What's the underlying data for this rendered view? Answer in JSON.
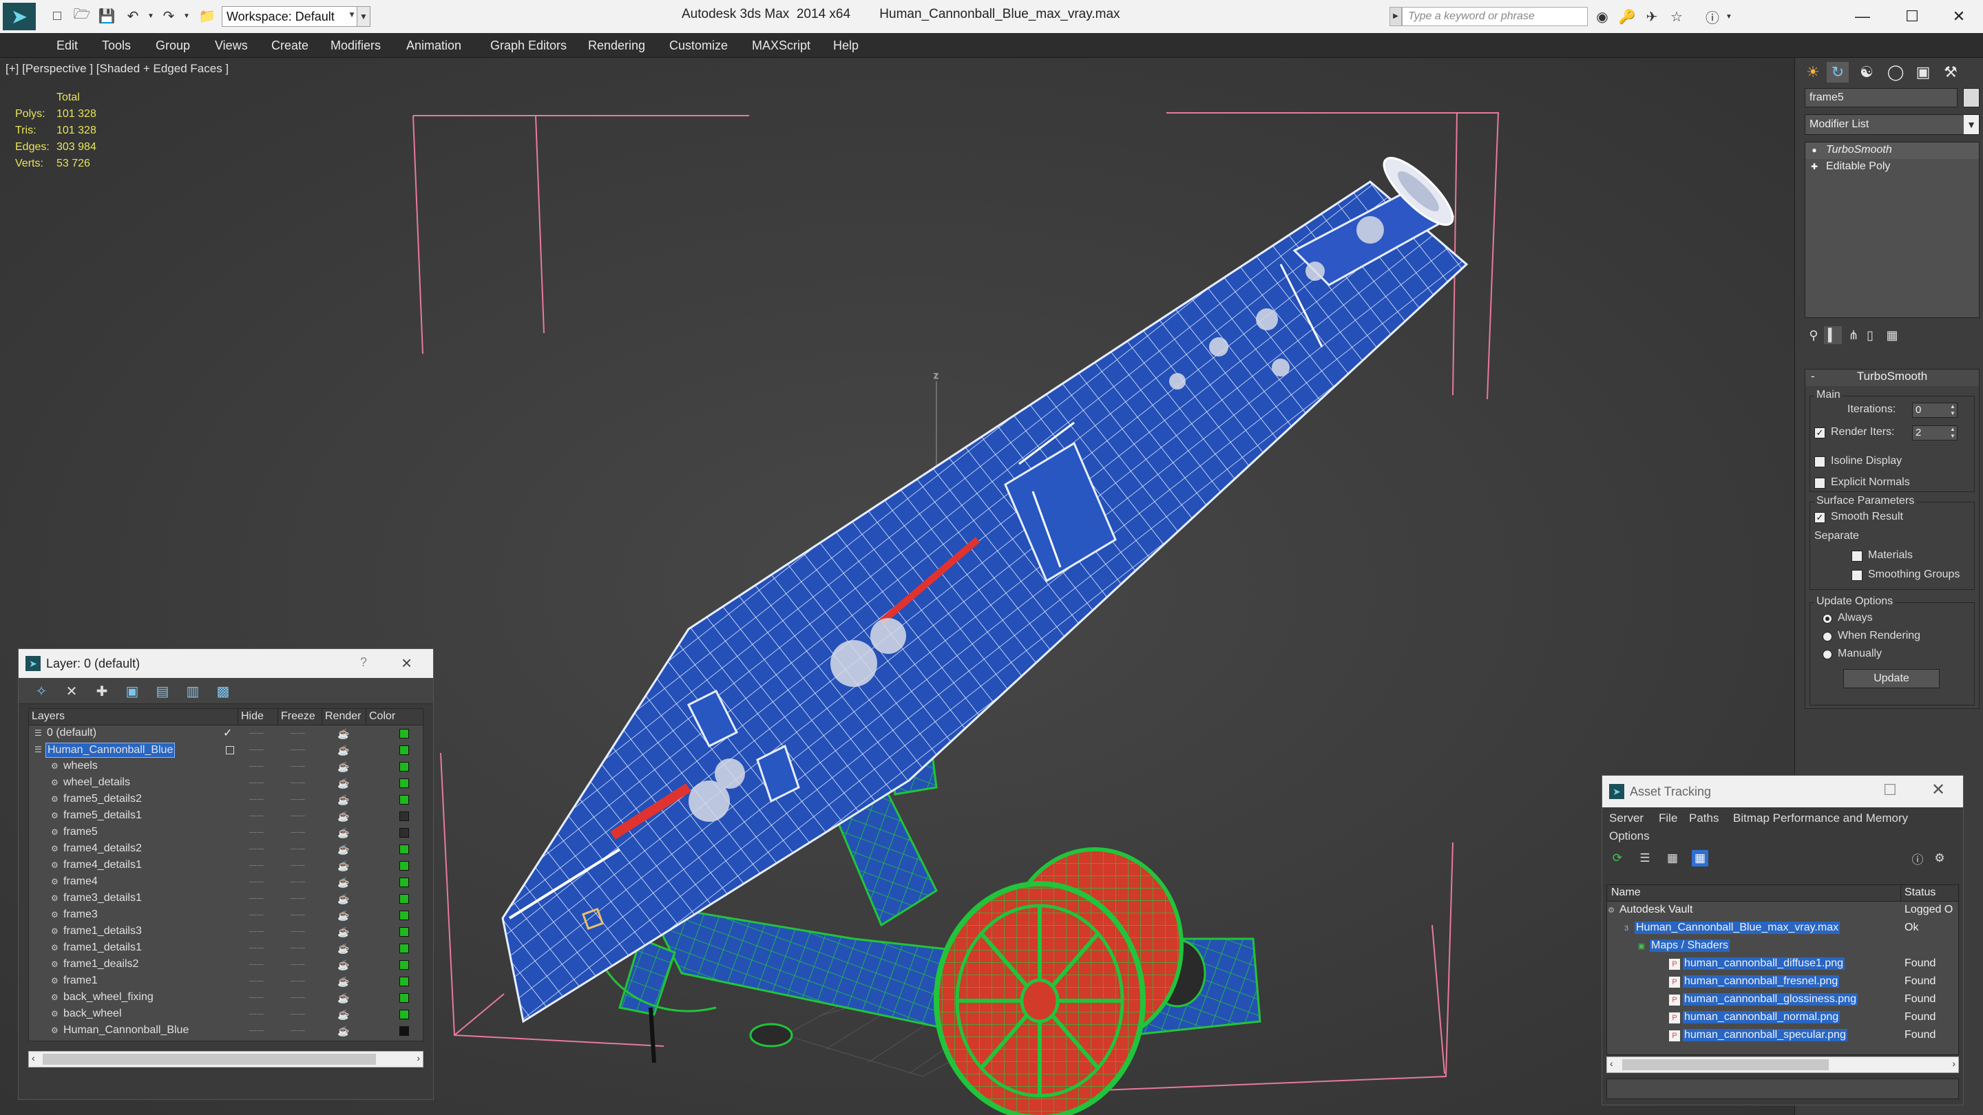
{
  "title_bar": {
    "app_title": "Autodesk 3ds Max  2014 x64",
    "file_name": "Human_Cannonball_Blue_max_vray.max",
    "workspace_value": "Workspace: Default",
    "search_placeholder": "Type a keyword or phrase"
  },
  "menu": [
    "Edit",
    "Tools",
    "Group",
    "Views",
    "Create",
    "Modifiers",
    "Animation",
    "Graph Editors",
    "Rendering",
    "Customize",
    "MAXScript",
    "Help"
  ],
  "viewport": {
    "label": "[+] [Perspective ] [Shaded + Edged Faces ]",
    "stats": {
      "header": "Total",
      "polys_label": "Polys:",
      "polys": "101 328",
      "tris_label": "Tris:",
      "tris": "101 328",
      "edges_label": "Edges:",
      "edges": "303 984",
      "verts_label": "Verts:",
      "verts": "53 726"
    },
    "axis_label": "z"
  },
  "layer_dialog": {
    "title": "Layer: 0 (default)",
    "help": "?",
    "columns": [
      "Layers",
      "Hide",
      "Freeze",
      "Render",
      "Color"
    ],
    "layers": [
      {
        "name": "0 (default)",
        "color": "#1fb81f"
      },
      {
        "name": "Human_Cannonball_Blue",
        "color": "#1fb81f"
      },
      {
        "name": "wheels",
        "color": "#1fb81f"
      },
      {
        "name": "wheel_details",
        "color": "#1fb81f"
      },
      {
        "name": "frame5_details2",
        "color": "#1fb81f"
      },
      {
        "name": "frame5_details1",
        "color": "#2e2e2e"
      },
      {
        "name": "frame5",
        "color": "#2e2e2e"
      },
      {
        "name": "frame4_details2",
        "color": "#1fb81f"
      },
      {
        "name": "frame4_details1",
        "color": "#1fb81f"
      },
      {
        "name": "frame4",
        "color": "#1fb81f"
      },
      {
        "name": "frame3_details1",
        "color": "#1fb81f"
      },
      {
        "name": "frame3",
        "color": "#1fb81f"
      },
      {
        "name": "frame1_details3",
        "color": "#1fb81f"
      },
      {
        "name": "frame1_details1",
        "color": "#1fb81f"
      },
      {
        "name": "frame1_deails2",
        "color": "#1fb81f"
      },
      {
        "name": "frame1",
        "color": "#1fb81f"
      },
      {
        "name": "back_wheel_fixing",
        "color": "#1fb81f"
      },
      {
        "name": "back_wheel",
        "color": "#1fb81f"
      },
      {
        "name": "Human_Cannonball_Blue",
        "color": "#111111"
      }
    ]
  },
  "command_panel": {
    "object_name": "frame5",
    "modifier_list": "Modifier List",
    "stack": [
      "TurboSmooth",
      "Editable Poly"
    ],
    "turbosmooth": {
      "header": "TurboSmooth",
      "collapse": "-",
      "main_label": "Main",
      "iterations_label": "Iterations:",
      "iterations": "0",
      "render_iters_label": "Render Iters:",
      "render_iters": "2",
      "isoline": "Isoline Display",
      "explicit": "Explicit Normals",
      "surface_label": "Surface Parameters",
      "smooth_result": "Smooth Result",
      "separate": "Separate",
      "materials": "Materials",
      "smoothing_groups": "Smoothing Groups",
      "update_label": "Update Options",
      "always": "Always",
      "when_rendering": "When Rendering",
      "manually": "Manually",
      "update_button": "Update"
    }
  },
  "asset_tracking": {
    "title": "Asset Tracking",
    "menu": [
      "Server",
      "File",
      "Paths",
      "Bitmap Performance and Memory",
      "Options"
    ],
    "columns": [
      "Name",
      "Status"
    ],
    "rows": [
      {
        "name": "Autodesk Vault",
        "status": "Logged O"
      },
      {
        "name": "Human_Cannonball_Blue_max_vray.max",
        "status": "Ok"
      },
      {
        "name": "Maps / Shaders",
        "status": ""
      },
      {
        "name": "human_cannonball_diffuse1.png",
        "status": "Found"
      },
      {
        "name": "human_cannonball_fresnel.png",
        "status": "Found"
      },
      {
        "name": "human_cannonball_glossiness.png",
        "status": "Found"
      },
      {
        "name": "human_cannonball_normal.png",
        "status": "Found"
      },
      {
        "name": "human_cannonball_specular.png",
        "status": "Found"
      }
    ]
  }
}
